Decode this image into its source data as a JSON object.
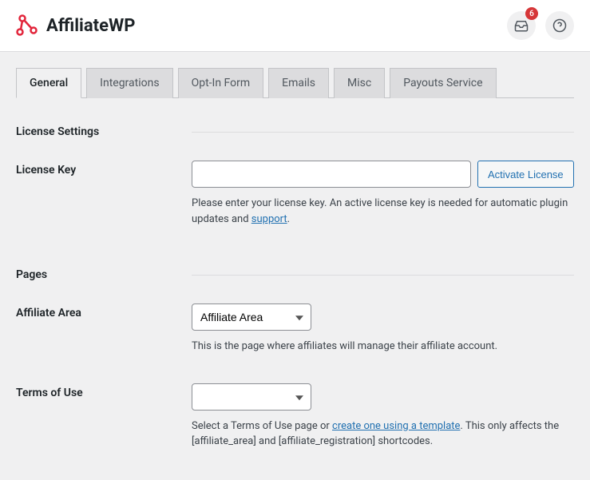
{
  "header": {
    "brand": "AffiliateWP",
    "notification_count": "6"
  },
  "tabs": [
    {
      "label": "General",
      "active": true
    },
    {
      "label": "Integrations",
      "active": false
    },
    {
      "label": "Opt-In Form",
      "active": false
    },
    {
      "label": "Emails",
      "active": false
    },
    {
      "label": "Misc",
      "active": false
    },
    {
      "label": "Payouts Service",
      "active": false
    }
  ],
  "sections": {
    "license": {
      "heading": "License Settings",
      "key_label": "License Key",
      "key_value": "",
      "activate_button": "Activate License",
      "help_prefix": "Please enter your license key. An active license key is needed for automatic plugin updates and ",
      "help_link": "support",
      "help_suffix": "."
    },
    "pages": {
      "heading": "Pages",
      "affiliate_area_label": "Affiliate Area",
      "affiliate_area_value": "Affiliate Area",
      "affiliate_area_help": "This is the page where affiliates will manage their affiliate account.",
      "terms_label": "Terms of Use",
      "terms_value": "",
      "terms_help_prefix": "Select a Terms of Use page or ",
      "terms_help_link": "create one using a template",
      "terms_help_suffix": ". This only affects the [affiliate_area] and [affiliate_registration] shortcodes."
    }
  }
}
